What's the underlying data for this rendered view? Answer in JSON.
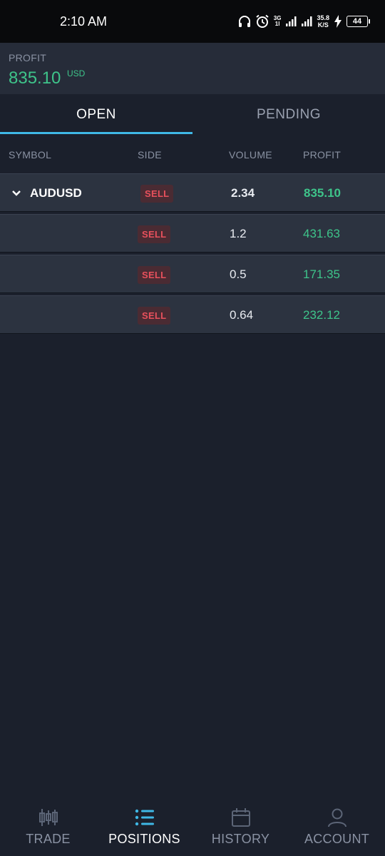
{
  "status_bar": {
    "time": "2:10 AM",
    "network_top": "3G",
    "network_bottom": "1l",
    "speed_value": "35.8",
    "speed_unit": "K/S",
    "battery": "44"
  },
  "header": {
    "profit_label": "PROFIT",
    "profit_value": "835.10",
    "currency": "USD"
  },
  "tabs": [
    {
      "label": "OPEN",
      "active": true
    },
    {
      "label": "PENDING",
      "active": false
    }
  ],
  "columns": {
    "symbol": "SYMBOL",
    "side": "SIDE",
    "volume": "VOLUME",
    "profit": "PROFIT"
  },
  "positions": {
    "group": {
      "symbol": "AUDUSD",
      "side": "SELL",
      "volume": "2.34",
      "profit": "835.10"
    },
    "rows": [
      {
        "side": "SELL",
        "volume": "1.2",
        "profit": "431.63"
      },
      {
        "side": "SELL",
        "volume": "0.5",
        "profit": "171.35"
      },
      {
        "side": "SELL",
        "volume": "0.64",
        "profit": "232.12"
      }
    ]
  },
  "nav": [
    {
      "label": "TRADE",
      "icon": "candlestick-icon",
      "active": false
    },
    {
      "label": "POSITIONS",
      "icon": "list-icon",
      "active": true
    },
    {
      "label": "HISTORY",
      "icon": "calendar-icon",
      "active": false
    },
    {
      "label": "ACCOUNT",
      "icon": "user-icon",
      "active": false
    }
  ],
  "colors": {
    "accent": "#3fb8e6",
    "profit_positive": "#3ec48a",
    "sell": "#e8505c",
    "background": "#1b202c"
  }
}
